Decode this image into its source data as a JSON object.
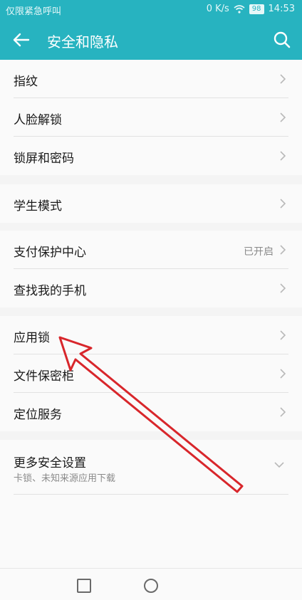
{
  "status_bar": {
    "carrier": "仅限紧急呼叫",
    "speed": "0 K/s",
    "battery": "98",
    "time": "14:53"
  },
  "app_bar": {
    "title": "安全和隐私",
    "back_icon": "arrow-left-icon",
    "search_icon": "search-icon"
  },
  "groups": [
    {
      "items": [
        {
          "label": "指纹"
        },
        {
          "label": "人脸解锁"
        },
        {
          "label": "锁屏和密码"
        }
      ]
    },
    {
      "items": [
        {
          "label": "学生模式"
        }
      ]
    },
    {
      "items": [
        {
          "label": "支付保护中心",
          "value": "已开启"
        },
        {
          "label": "查找我的手机"
        }
      ]
    },
    {
      "items": [
        {
          "label": "应用锁"
        },
        {
          "label": "文件保密柜"
        },
        {
          "label": "定位服务"
        }
      ]
    }
  ],
  "more_settings": {
    "label": "更多安全设置",
    "subtitle": "卡锁、未知来源应用下载"
  },
  "annotation": {
    "color": "#d8262b",
    "target": "应用锁"
  },
  "colors": {
    "accent": "#27b3c0",
    "annotation": "#d8262b"
  }
}
